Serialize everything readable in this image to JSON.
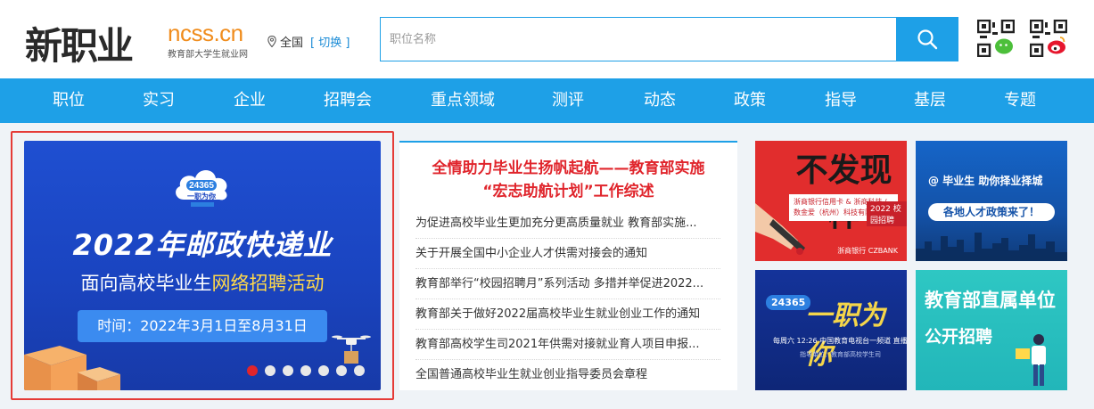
{
  "header": {
    "logo_text": "新职业",
    "brand_en": "ncss.cn",
    "brand_sub": "教育部大学生就业网",
    "location": "全国",
    "switch_label": "[ 切换 ]",
    "search_placeholder": "职位名称",
    "search_icon": "search-icon",
    "qr_icons": [
      "wechat-qr-icon",
      "weibo-qr-icon"
    ]
  },
  "nav": {
    "items": [
      "职位",
      "实习",
      "企业",
      "招聘会",
      "重点领域",
      "测评",
      "动态",
      "政策",
      "指导",
      "基层",
      "专题"
    ]
  },
  "banner": {
    "badge_number": "24365",
    "badge_text": "一职为你",
    "title": "2022年邮政快递业",
    "subtitle_prefix": "面向高校毕业生",
    "subtitle_highlight": "网络招聘活动",
    "date": "时间：2022年3月1日至8月31日",
    "slide_count": 7,
    "active_slide": 1
  },
  "news": {
    "headline_line1": "全情助力毕业生扬帆起航——教育部实施",
    "headline_line2": "“宏志助航计划”工作综述",
    "items": [
      "为促进高校毕业生更加充分更高质量就业 教育部实施...",
      "关于开展全国中小企业人才供需对接会的通知",
      "教育部举行“校园招聘月”系列活动 多措并举促进2022...",
      "教育部关于做好2022届高校毕业生就业创业工作的通知",
      "教育部高校学生司2021年供需对接就业育人项目申报...",
      "全国普通高校毕业生就业创业指导委员会章程"
    ]
  },
  "tiles": {
    "tile1": {
      "big_text": "不发现样",
      "box_text": "浙商银行信用卡 & 浙商科技 / 数金爱（杭州）科技有限公司",
      "tag": "2022 校园招聘",
      "foot": "浙商银行 CZBANK"
    },
    "tile2": {
      "line": "@ 毕业生 助你择业择城",
      "pill": "各地人才政策来了！"
    },
    "tile3": {
      "badge": "24365",
      "title": "一职为你",
      "line": "每周六 12:26  中国教育电视台一频道  直播",
      "line2": "指导单位：教育部高校学生司"
    },
    "tile4": {
      "title": "教育部直属单位",
      "sub": "公开招聘"
    }
  },
  "colors": {
    "primary": "#1ea0e7",
    "accent_orange": "#f08c1c",
    "headline_red": "#e0252c",
    "banner_blue": "#1f4fd1"
  }
}
